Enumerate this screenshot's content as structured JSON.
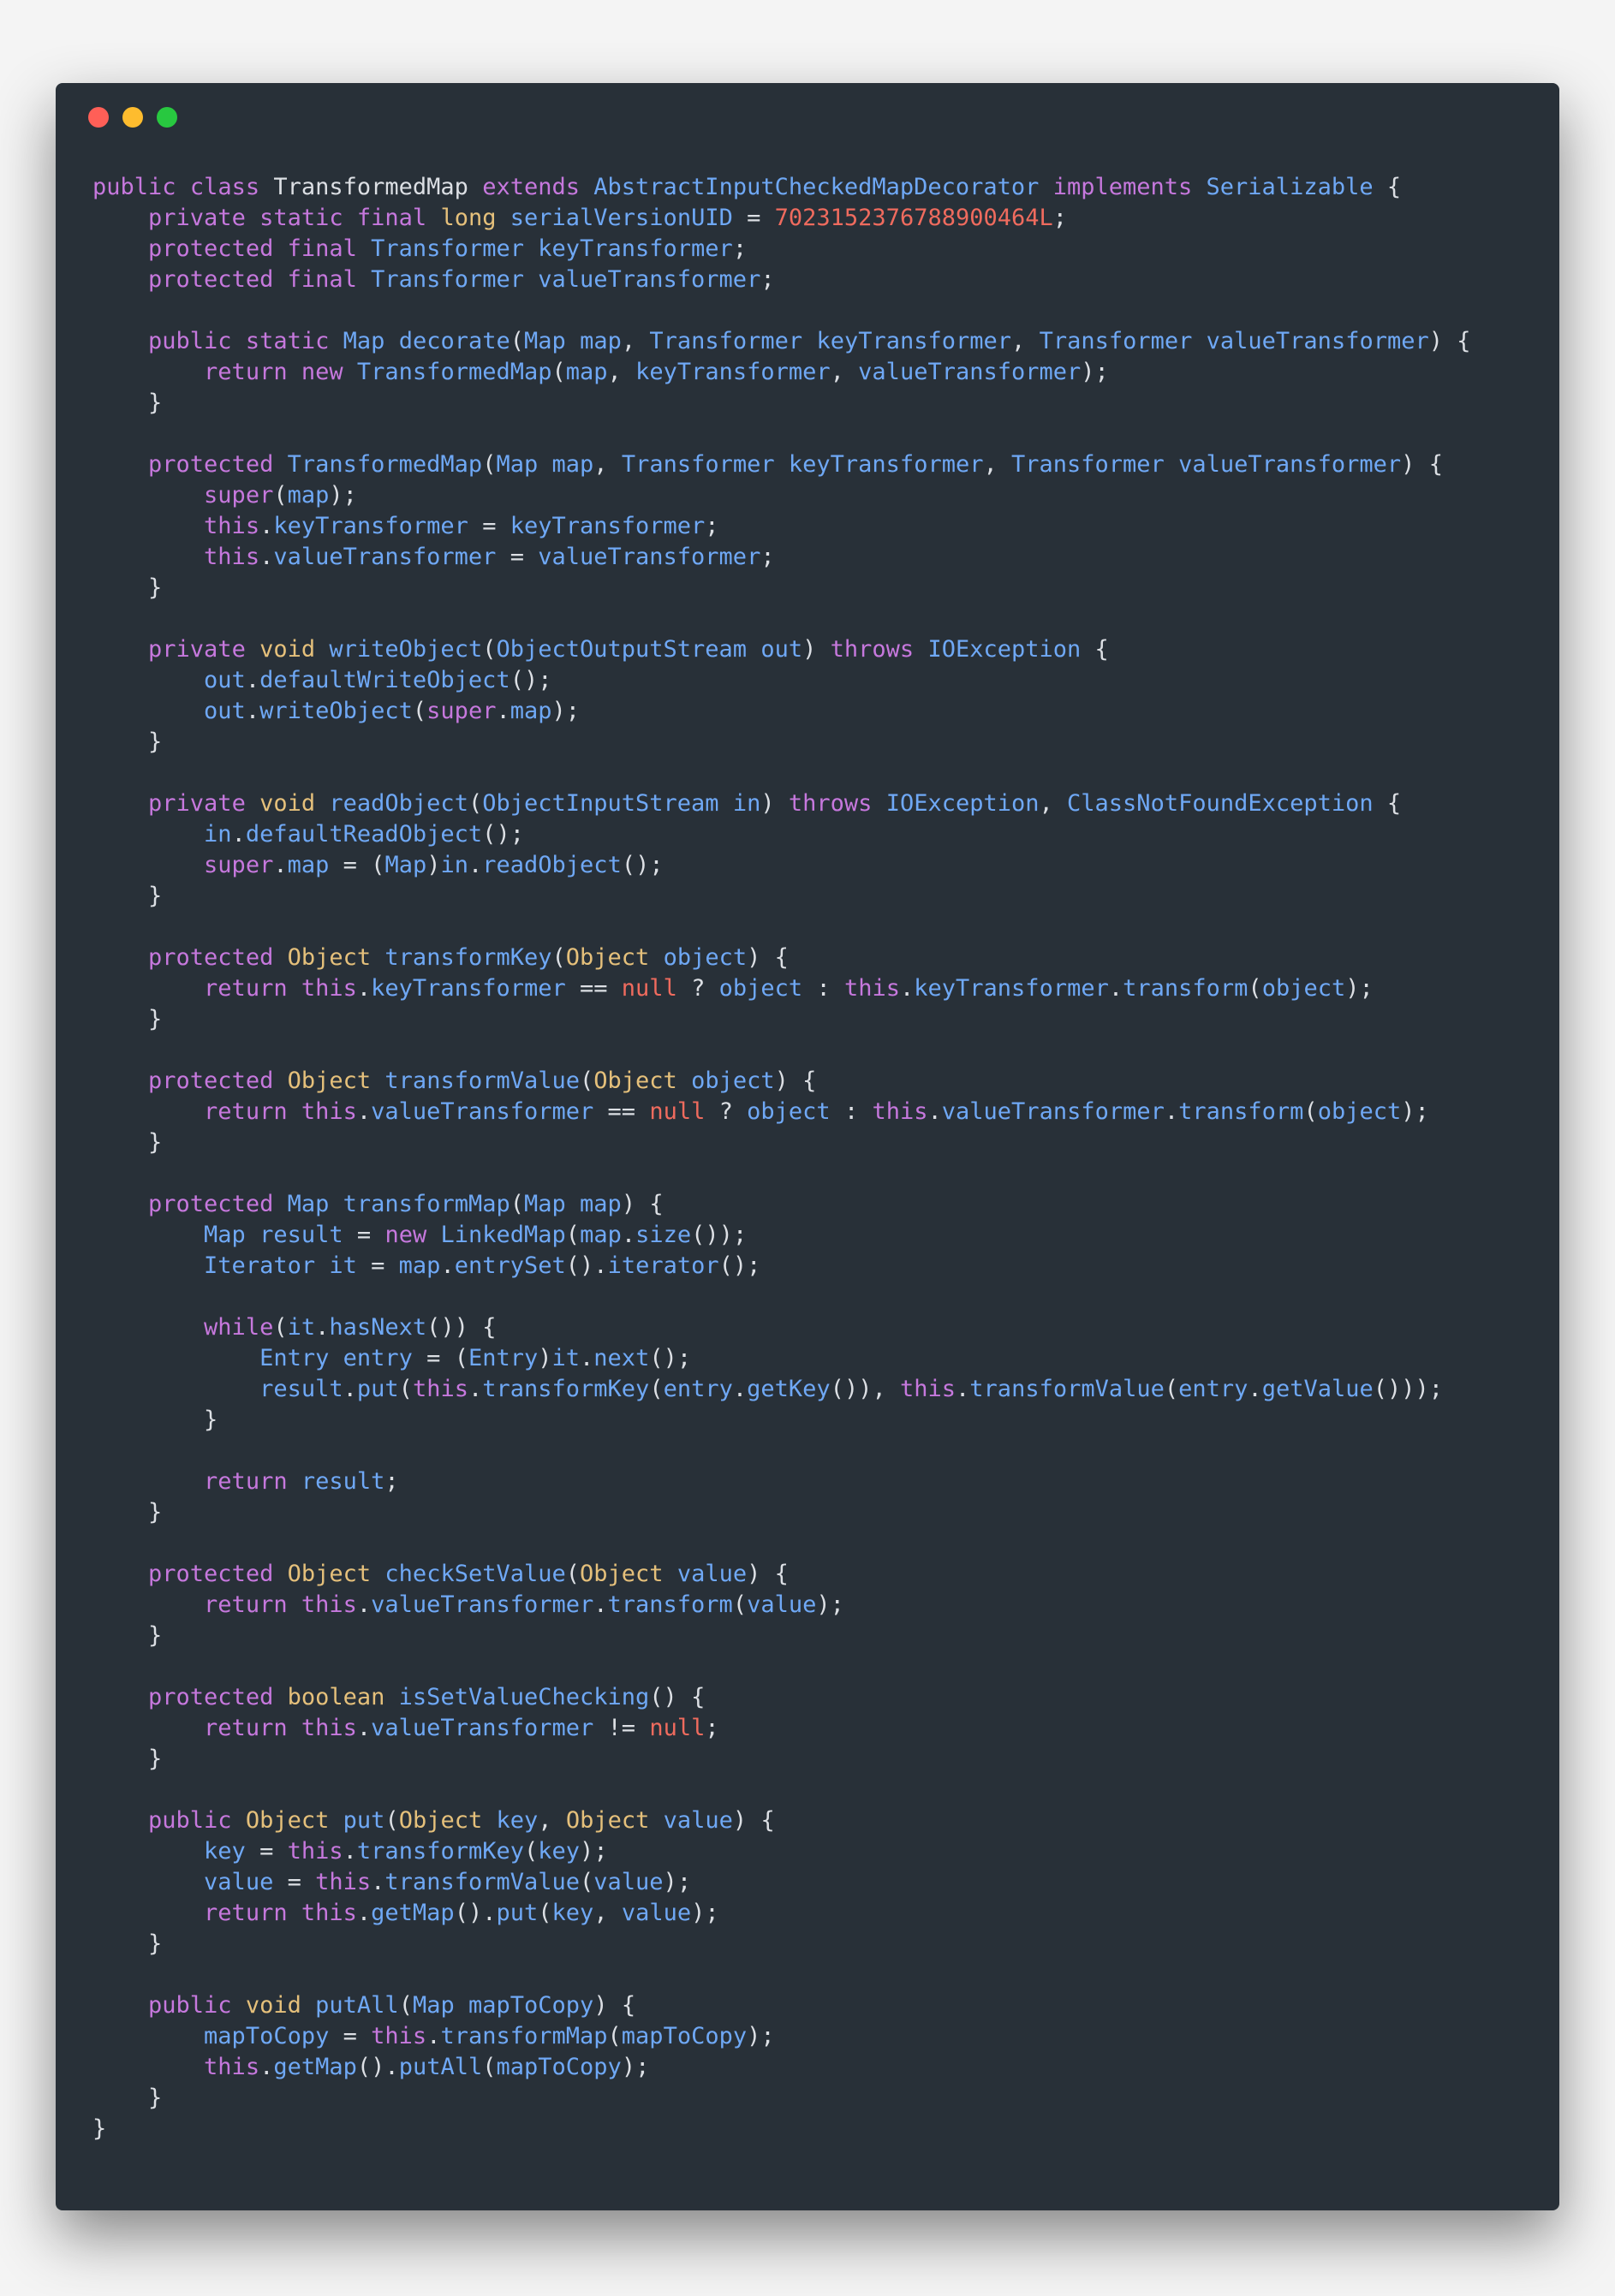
{
  "window": {
    "buttons": [
      {
        "name": "close",
        "color": "#ff5f57"
      },
      {
        "name": "minimize",
        "color": "#febc2e"
      },
      {
        "name": "maximize",
        "color": "#28c840"
      }
    ]
  },
  "colors": {
    "background": "#283038",
    "keyword": "#c678dd",
    "type": "#e5c07b",
    "identifier": "#6fa8f5",
    "literal": "#ef6b5e",
    "plain": "#dcdfe4"
  },
  "code_lines": [
    "public class TransformedMap extends AbstractInputCheckedMapDecorator implements Serializable {",
    "    private static final long serialVersionUID = 7023152376788900464L;",
    "    protected final Transformer keyTransformer;",
    "    protected final Transformer valueTransformer;",
    "",
    "    public static Map decorate(Map map, Transformer keyTransformer, Transformer valueTransformer) {",
    "        return new TransformedMap(map, keyTransformer, valueTransformer);",
    "    }",
    "",
    "    protected TransformedMap(Map map, Transformer keyTransformer, Transformer valueTransformer) {",
    "        super(map);",
    "        this.keyTransformer = keyTransformer;",
    "        this.valueTransformer = valueTransformer;",
    "    }",
    "",
    "    private void writeObject(ObjectOutputStream out) throws IOException {",
    "        out.defaultWriteObject();",
    "        out.writeObject(super.map);",
    "    }",
    "",
    "    private void readObject(ObjectInputStream in) throws IOException, ClassNotFoundException {",
    "        in.defaultReadObject();",
    "        super.map = (Map)in.readObject();",
    "    }",
    "",
    "    protected Object transformKey(Object object) {",
    "        return this.keyTransformer == null ? object : this.keyTransformer.transform(object);",
    "    }",
    "",
    "    protected Object transformValue(Object object) {",
    "        return this.valueTransformer == null ? object : this.valueTransformer.transform(object);",
    "    }",
    "",
    "    protected Map transformMap(Map map) {",
    "        Map result = new LinkedMap(map.size());",
    "        Iterator it = map.entrySet().iterator();",
    "",
    "        while(it.hasNext()) {",
    "            Entry entry = (Entry)it.next();",
    "            result.put(this.transformKey(entry.getKey()), this.transformValue(entry.getValue()));",
    "        }",
    "",
    "        return result;",
    "    }",
    "",
    "    protected Object checkSetValue(Object value) {",
    "        return this.valueTransformer.transform(value);",
    "    }",
    "",
    "    protected boolean isSetValueChecking() {",
    "        return this.valueTransformer != null;",
    "    }",
    "",
    "    public Object put(Object key, Object value) {",
    "        key = this.transformKey(key);",
    "        value = this.transformValue(value);",
    "        return this.getMap().put(key, value);",
    "    }",
    "",
    "    public void putAll(Map mapToCopy) {",
    "        mapToCopy = this.transformMap(mapToCopy);",
    "        this.getMap().putAll(mapToCopy);",
    "    }",
    "}"
  ]
}
